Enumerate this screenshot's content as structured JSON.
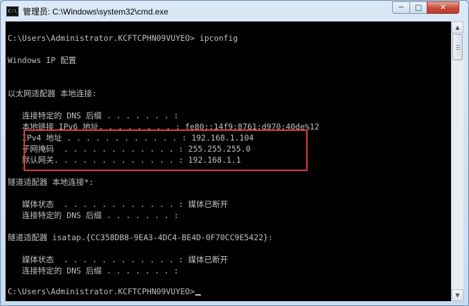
{
  "window": {
    "title": "管理员: C:\\Windows\\system32\\cmd.exe",
    "icon_label": "C:\\",
    "controls": {
      "minimize": "─",
      "maximize": "□",
      "close": "✕"
    }
  },
  "console": {
    "lines": [
      "C:\\Users\\Administrator.KCFTCPHN09VUYEO> ipconfig",
      "",
      "Windows IP 配置",
      "",
      "",
      "以太网适配器 本地连接:",
      "",
      "   连接特定的 DNS 后缀 . . . . . . . :",
      "   本地链接 IPv6 地址. . . . . . . . : fe80::14f9:8761:d970:40de%12",
      "   IPv4 地址 . . . . . . . . . . . . : 192.168.1.104",
      "   子网掩码  . . . . . . . . . . . . : 255.255.255.0",
      "   默认网关. . . . . . . . . . . . . : 192.168.1.1",
      "",
      "隧道适配器 本地连接*:",
      "",
      "   媒体状态  . . . . . . . . . . . . : 媒体已断开",
      "   连接特定的 DNS 后缀 . . . . . . . :",
      "",
      "隧道适配器 isatap.{CC358DB8-9EA3-4DC4-BE4D-0F70CC9E5422}:",
      "",
      "   媒体状态  . . . . . . . . . . . . : 媒体已断开",
      "   连接特定的 DNS 后缀 . . . . . . . :",
      "",
      "C:\\Users\\Administrator.KCFTCPHN09VUYEO>"
    ]
  },
  "colors": {
    "console_bg": "#000000",
    "console_fg": "#c0c0c0",
    "highlight_border": "#e03b3b",
    "close_button": "#c9483a"
  },
  "icons": [
    "cmd-app-icon",
    "minimize-icon",
    "maximize-icon",
    "close-icon",
    "scroll-up-icon",
    "scroll-down-icon"
  ]
}
